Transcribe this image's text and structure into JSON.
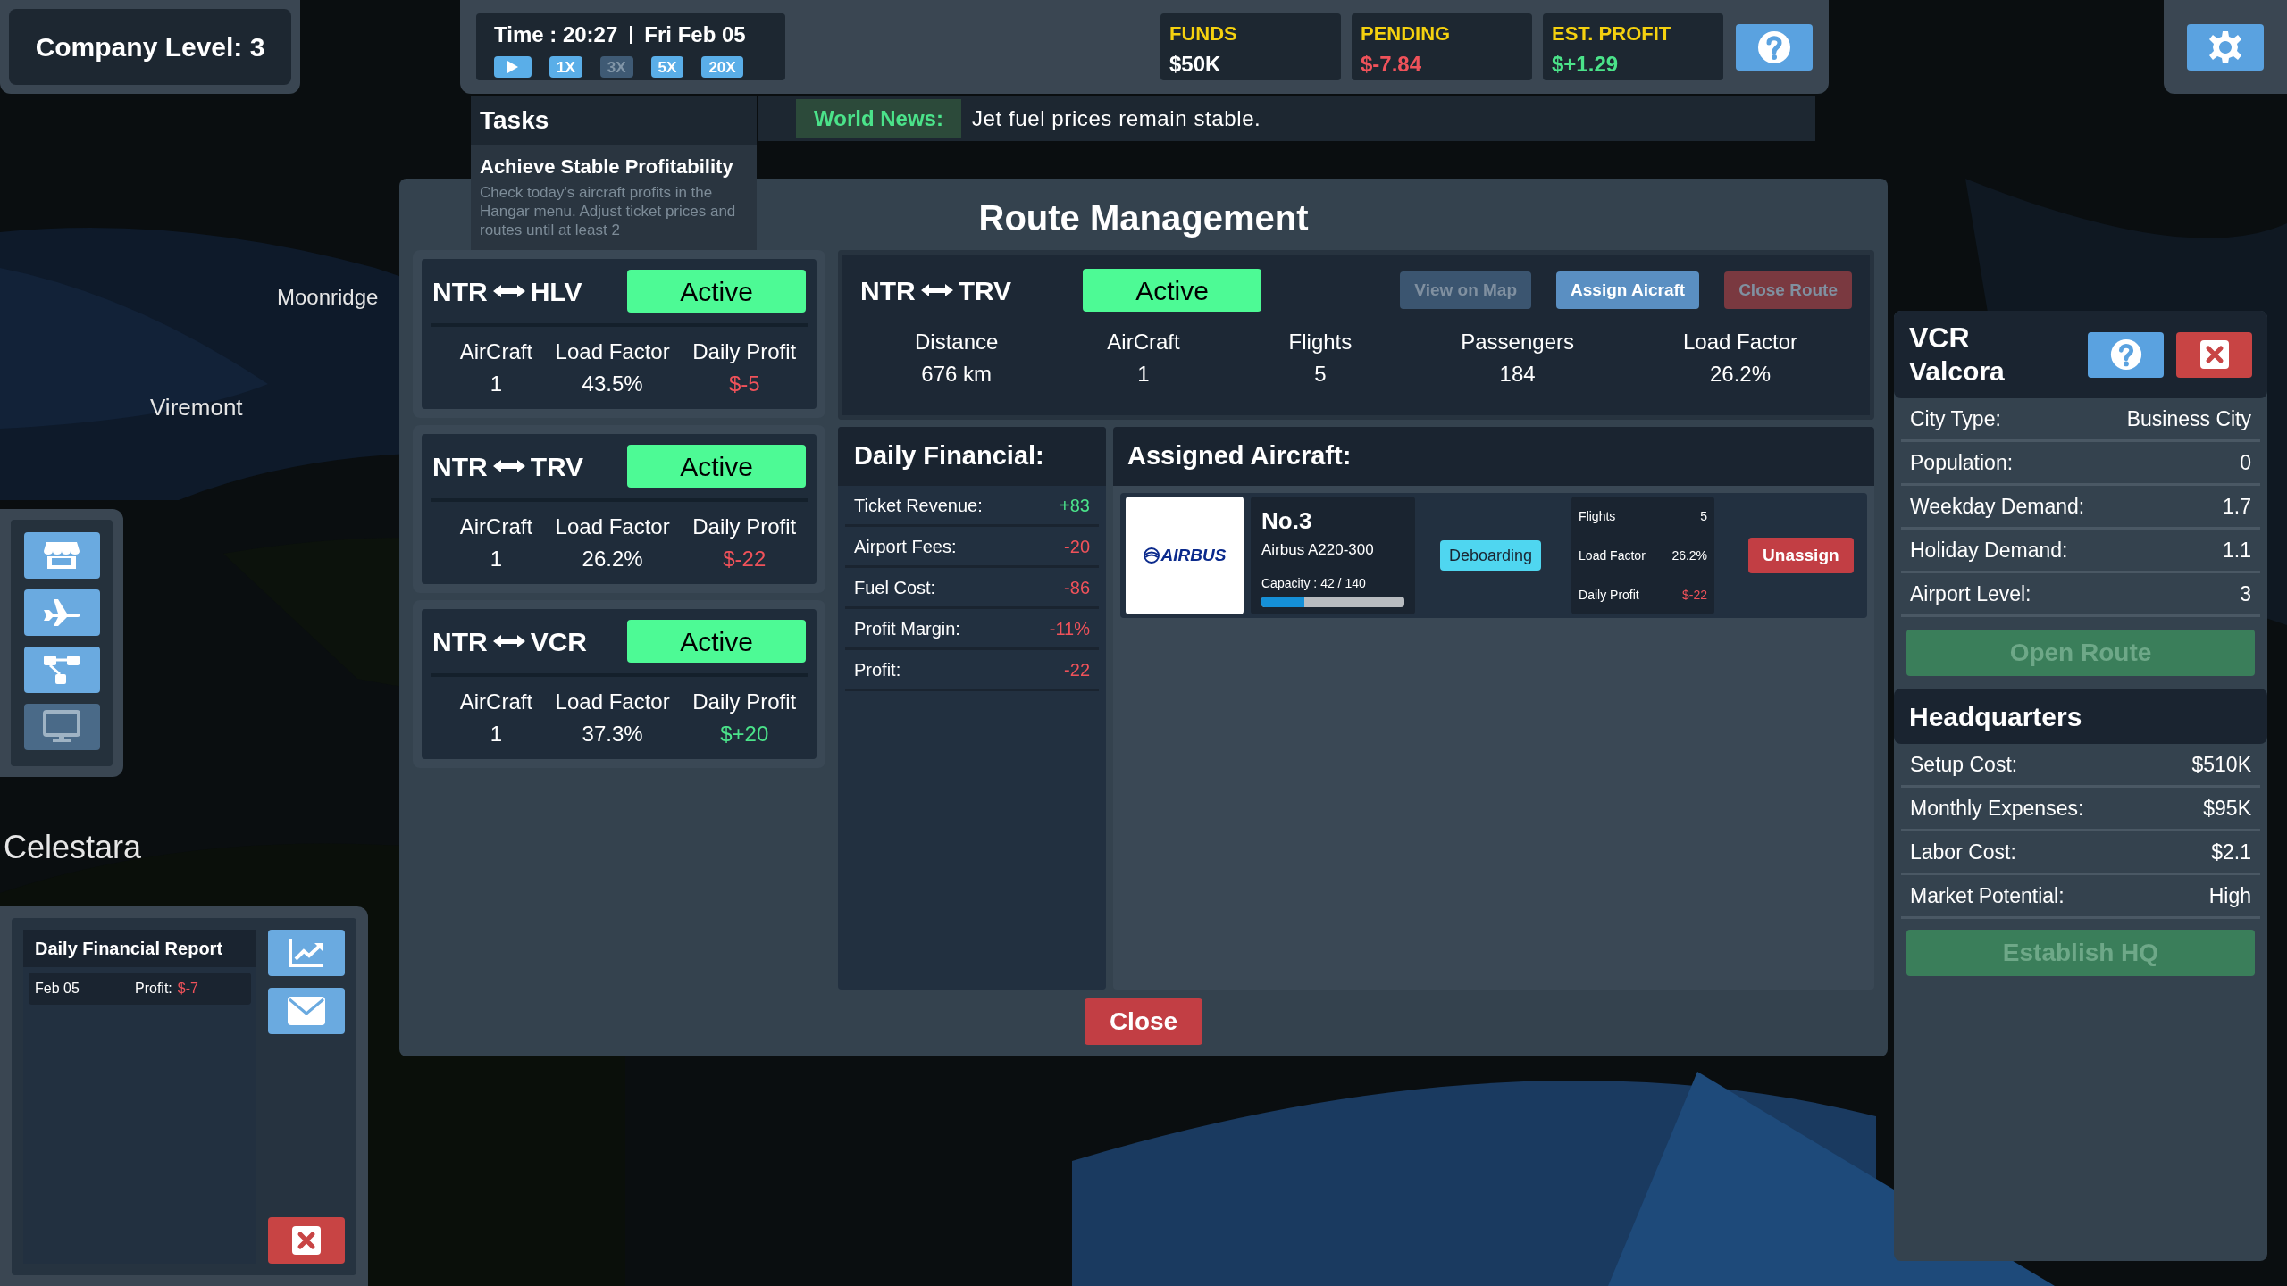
{
  "company": {
    "label": "Company Level: 3"
  },
  "clock": {
    "time": "Time : 20:27",
    "date": "Fri Feb 05",
    "speeds": [
      {
        "kind": "play",
        "selected": false
      },
      {
        "kind": "speed",
        "label": "1X",
        "selected": false
      },
      {
        "kind": "speed",
        "label": "3X",
        "selected": true
      },
      {
        "kind": "speed",
        "label": "5X",
        "selected": false
      },
      {
        "kind": "speed",
        "label": "20X",
        "selected": false
      }
    ]
  },
  "stats": [
    {
      "label": "FUNDS",
      "value": "$50K",
      "kind": "neutral"
    },
    {
      "label": "PENDING",
      "value": "$-7.84",
      "kind": "negative"
    },
    {
      "label": "EST. PROFIT",
      "value": "$+1.29",
      "kind": "positive"
    }
  ],
  "tasks": {
    "title": "Tasks",
    "task_title": "Achieve Stable Profitability",
    "description": "Check today's aircraft profits in the Hangar menu. Adjust ticket prices and routes until at least 2"
  },
  "news": {
    "label": "World News:",
    "text": "Jet fuel prices remain stable."
  },
  "map_labels": [
    "Moonridge",
    "Viremont",
    "Celestara"
  ],
  "toolbar": [
    {
      "kind": "shop",
      "disabled": false
    },
    {
      "kind": "plane",
      "disabled": false
    },
    {
      "kind": "network",
      "disabled": false
    },
    {
      "kind": "monitor",
      "disabled": true
    }
  ],
  "report": {
    "title": "Daily Financial Report",
    "entries": [
      {
        "date": "Feb 05",
        "label": "Profit:",
        "value": "$-7",
        "kind": "negative"
      }
    ]
  },
  "modal": {
    "title": "Route Management",
    "routes": [
      {
        "from": "NTR",
        "to": "HLV",
        "status": "Active",
        "active": true,
        "stats": [
          {
            "label": "AirCraft",
            "value": "1",
            "kind": "neutral"
          },
          {
            "label": "Load Factor",
            "value": "43.5%",
            "kind": "neutral"
          },
          {
            "label": "Daily Profit",
            "value": "$-5",
            "kind": "negative"
          }
        ]
      },
      {
        "from": "NTR",
        "to": "TRV",
        "status": "Active",
        "active": true,
        "stats": [
          {
            "label": "AirCraft",
            "value": "1",
            "kind": "neutral"
          },
          {
            "label": "Load Factor",
            "value": "26.2%",
            "kind": "neutral"
          },
          {
            "label": "Daily Profit",
            "value": "$-22",
            "kind": "negative"
          }
        ]
      },
      {
        "from": "NTR",
        "to": "VCR",
        "status": "Active",
        "active": true,
        "stats": [
          {
            "label": "AirCraft",
            "value": "1",
            "kind": "neutral"
          },
          {
            "label": "Load Factor",
            "value": "37.3%",
            "kind": "neutral"
          },
          {
            "label": "Daily Profit",
            "value": "$+20",
            "kind": "positive"
          }
        ]
      }
    ],
    "detail": {
      "from": "NTR",
      "to": "TRV",
      "status": "Active",
      "active": true,
      "actions": [
        {
          "label": "View on Map",
          "kind": "neutral",
          "disabled": true
        },
        {
          "label": "Assign Aicraft",
          "kind": "primary",
          "disabled": false
        },
        {
          "label": "Close Route",
          "kind": "danger",
          "disabled": true
        }
      ],
      "stats": [
        {
          "label": "Distance",
          "value": "676 km"
        },
        {
          "label": "AirCraft",
          "value": "1"
        },
        {
          "label": "Flights",
          "value": "5"
        },
        {
          "label": "Passengers",
          "value": "184"
        },
        {
          "label": "Load Factor",
          "value": "26.2%"
        }
      ]
    },
    "financial": {
      "title": "Daily Financial:",
      "rows": [
        {
          "label": "Ticket Revenue:",
          "value": "+83",
          "kind": "positive"
        },
        {
          "label": "Airport Fees:",
          "value": "-20",
          "kind": "negative"
        },
        {
          "label": "Fuel Cost:",
          "value": "-86",
          "kind": "negative"
        },
        {
          "label": "Profit Margin:",
          "value": "-11%",
          "kind": "negative"
        },
        {
          "label": "Profit:",
          "value": "-22",
          "kind": "negative"
        }
      ]
    },
    "assigned": {
      "title": "Assigned Aircraft:",
      "aircraft": [
        {
          "logo": "AIRBUS",
          "name": "No.3",
          "model": "Airbus A220-300",
          "capacity": "Capacity : 42 / 140",
          "level": 0.3,
          "status": "Deboarding",
          "stats": [
            {
              "label": "Flights",
              "value": "5",
              "kind": "neutral"
            },
            {
              "label": "Load Factor",
              "value": "26.2%",
              "kind": "neutral"
            },
            {
              "label": "Daily Profit",
              "value": "$-22",
              "kind": "negative"
            }
          ],
          "action": "Unassign"
        }
      ]
    },
    "close": "Close"
  },
  "city": {
    "code": "VCR",
    "name": "Valcora",
    "rows": [
      {
        "label": "City Type:",
        "value": "Business City"
      },
      {
        "label": "Population:",
        "value": "0"
      },
      {
        "label": "Weekday Demand:",
        "value": "1.7"
      },
      {
        "label": "Holiday Demand:",
        "value": "1.1"
      },
      {
        "label": "Airport Level:",
        "value": "3"
      }
    ],
    "open_route": {
      "label": "Open Route",
      "disabled": true
    },
    "hq": {
      "title": "Headquarters",
      "rows": [
        {
          "label": "Setup Cost:",
          "value": "$510K"
        },
        {
          "label": "Monthly Expenses:",
          "value": "$95K"
        },
        {
          "label": "Labor Cost:",
          "value": "$2.1"
        },
        {
          "label": "Market Potential:",
          "value": "High"
        }
      ],
      "button": {
        "label": "Establish HQ",
        "disabled": true
      }
    }
  }
}
